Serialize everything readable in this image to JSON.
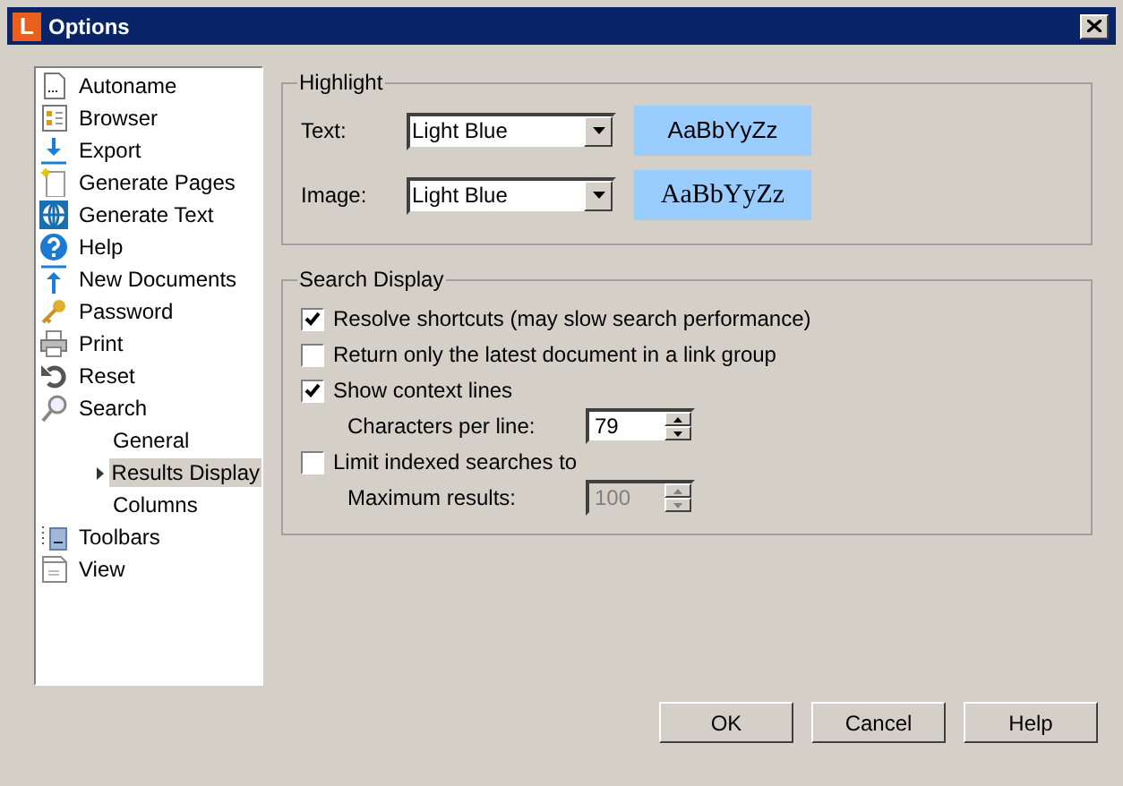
{
  "window": {
    "app_icon": "L",
    "title": "Options"
  },
  "tree": [
    {
      "label": "Autoname",
      "selected": false
    },
    {
      "label": "Browser",
      "selected": false
    },
    {
      "label": "Export",
      "selected": false
    },
    {
      "label": "Generate Pages",
      "selected": false
    },
    {
      "label": "Generate Text",
      "selected": false
    },
    {
      "label": "Help",
      "selected": false
    },
    {
      "label": "New Documents",
      "selected": false
    },
    {
      "label": "Password",
      "selected": false
    },
    {
      "label": "Print",
      "selected": false
    },
    {
      "label": "Reset",
      "selected": false
    },
    {
      "label": "Search",
      "selected": false,
      "children": [
        {
          "label": "General",
          "selected": false
        },
        {
          "label": "Results Display",
          "selected": true
        },
        {
          "label": "Columns",
          "selected": false
        }
      ]
    },
    {
      "label": "Toolbars",
      "selected": false
    },
    {
      "label": "View",
      "selected": false
    }
  ],
  "highlight": {
    "title": "Highlight",
    "rows": [
      {
        "label": "Text:",
        "value": "Light Blue",
        "sample": "AaBbYyZz",
        "kind": "sans"
      },
      {
        "label": "Image:",
        "value": "Light Blue",
        "sample": "AaBbYyZz",
        "kind": "serif"
      }
    ]
  },
  "search_display": {
    "title": "Search Display",
    "options": [
      {
        "kind": "checkbox",
        "label": "Resolve shortcuts (may slow search performance)",
        "checked": true
      },
      {
        "kind": "checkbox",
        "label": "Return only the latest document in a link group",
        "checked": false
      },
      {
        "kind": "checkbox",
        "label": "Show context lines",
        "checked": true
      },
      {
        "kind": "spinner",
        "label": "Characters per line:",
        "value": "79",
        "disabled": false
      },
      {
        "kind": "checkbox",
        "label": "Limit indexed searches to",
        "checked": false
      },
      {
        "kind": "spinner",
        "label": "Maximum results:",
        "value": "100",
        "disabled": true
      }
    ]
  },
  "buttons": [
    "OK",
    "Cancel",
    "Help"
  ]
}
